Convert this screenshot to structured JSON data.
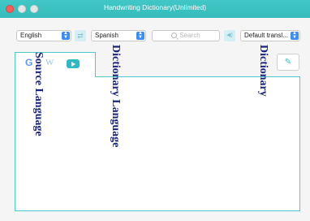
{
  "window": {
    "title": "Handwriting Dictionary(Unlimited)"
  },
  "toolbar": {
    "source_language": "English",
    "dictionary_language": "Spanish",
    "search_placeholder": "Search",
    "dictionary_select": "Default transl..."
  },
  "tabs": {
    "google": "G",
    "wiki": "W"
  },
  "annotations": {
    "source_language": "Source Language",
    "dictionary_language": "Dictionary Language",
    "dictionary": "Dictionary"
  },
  "colors": {
    "accent": "#40c7c6",
    "annotation": "#1a237e",
    "select_chevron": "#3a8df6"
  },
  "icons": [
    "swap-icon",
    "search-icon",
    "speaker-icon",
    "youtube-icon",
    "edit-icon"
  ]
}
